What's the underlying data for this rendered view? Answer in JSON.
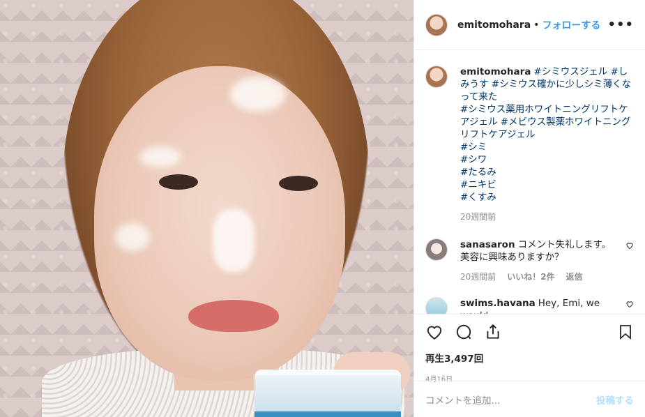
{
  "post": {
    "username": "emitomohara",
    "dot": "•",
    "follow_label": "フォローする",
    "more_label": "•••"
  },
  "caption": {
    "username": "emitomohara",
    "segments": [
      {
        "text": "#シミウスジェル",
        "hashtag": true
      },
      {
        "text": " ",
        "hashtag": false
      },
      {
        "text": "#しみうす",
        "hashtag": true
      },
      {
        "text": " ",
        "hashtag": false
      },
      {
        "text": "#シミウス確かに少しシミ薄くなって来た",
        "hashtag": true
      }
    ],
    "lines": [
      "#シミウス薬用ホワイトニングリフトケアジェル #メビウス製薬ホワイトニングリフトケアジェル",
      "#シミ",
      "#シワ",
      "#たるみ",
      "#ニキビ",
      "#くすみ"
    ],
    "time": "20週間前"
  },
  "comments": [
    {
      "username": "sanasaron",
      "text": "コメント失礼します。美容に興味ありますか？",
      "time": "20週間前",
      "likes": "いいね！2件",
      "reply": "返信"
    },
    {
      "username": "swims.havana",
      "text": "Hey, Emi, we would"
    }
  ],
  "stats": {
    "views": "再生3,497回",
    "date": "4月16日"
  },
  "compose": {
    "placeholder": "コメントを追加...",
    "post_label": "投稿する"
  }
}
